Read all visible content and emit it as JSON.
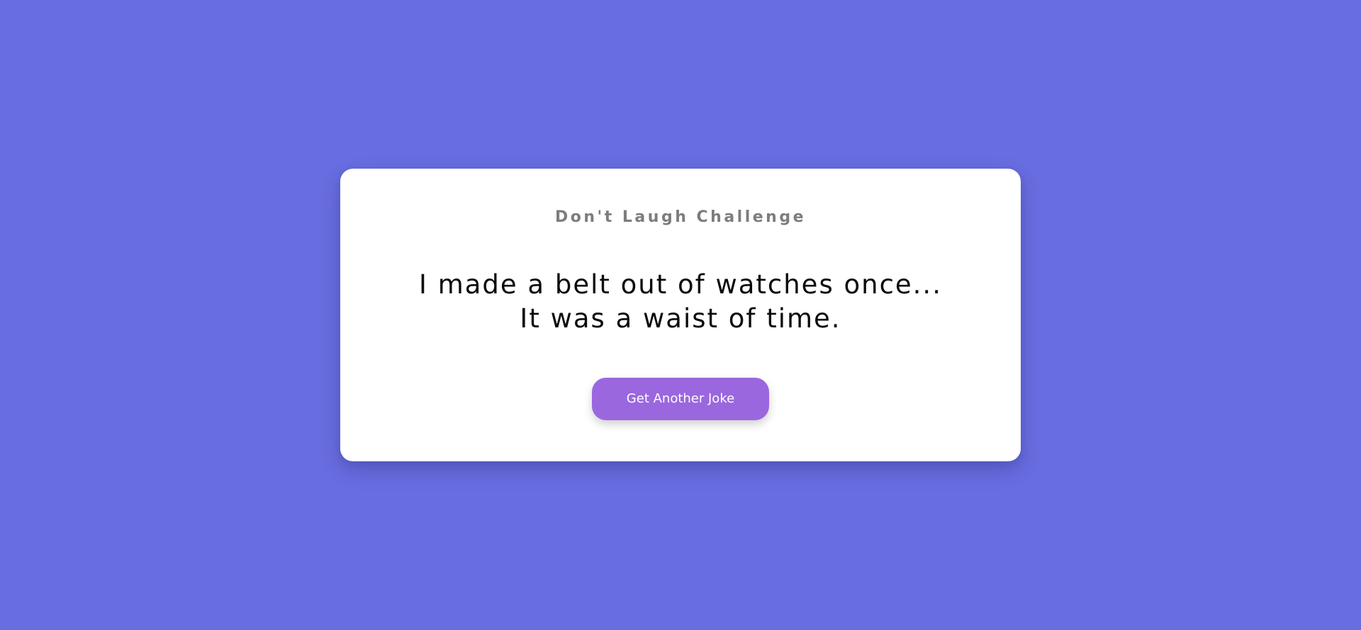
{
  "app": {
    "title": "Don't Laugh Challenge"
  },
  "joke": {
    "text": "I made a belt out of watches once... It was a waist of time."
  },
  "actions": {
    "next_joke_label": "Get Another Joke"
  },
  "colors": {
    "background": "#686de0",
    "card": "#ffffff",
    "title": "#7d7d7d",
    "joke_text": "#0a0a0a",
    "button": "#9b67df",
    "button_text": "#ffffff"
  }
}
